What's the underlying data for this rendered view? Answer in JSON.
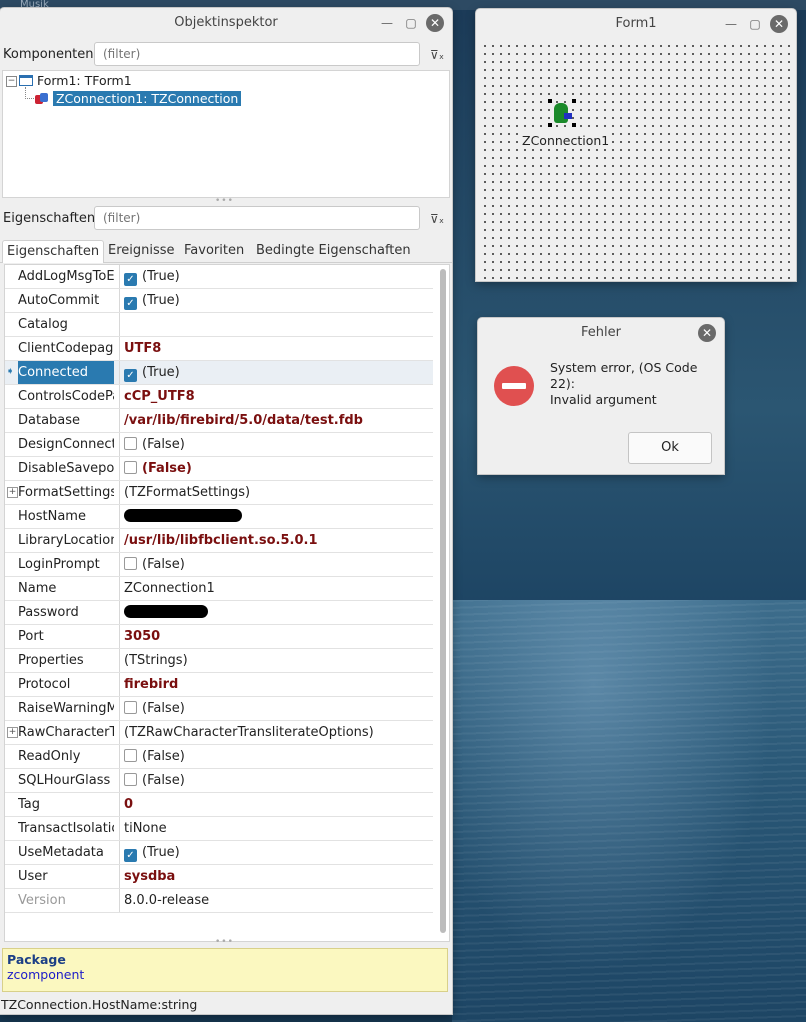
{
  "desktop": {
    "topstrip_text": "Musik"
  },
  "object_inspector": {
    "title": "Objektinspektor",
    "components_label": "Komponenten",
    "components_filter_placeholder": "(filter)",
    "tree": [
      {
        "label": "Form1: TForm1"
      },
      {
        "label": "ZConnection1: TZConnection"
      }
    ],
    "properties_label": "Eigenschaften",
    "properties_filter_placeholder": "(filter)",
    "tabs": [
      "Eigenschaften",
      "Ereignisse",
      "Favoriten",
      "Bedingte Eigenschaften"
    ],
    "rows": [
      {
        "name": "AddLogMsgToExceptionOrWarningMsg",
        "value": "(True)"
      },
      {
        "name": "AutoCommit",
        "value": "(True)"
      },
      {
        "name": "Catalog",
        "value": ""
      },
      {
        "name": "ClientCodepage",
        "value": "UTF8"
      },
      {
        "name": "Connected",
        "value": "(True)"
      },
      {
        "name": "ControlsCodePage",
        "value": "cCP_UTF8"
      },
      {
        "name": "Database",
        "value": "/var/lib/firebird/5.0/data/test.fdb"
      },
      {
        "name": "DesignConnection",
        "value": "(False)"
      },
      {
        "name": "DisableSavepoints",
        "value": "(False)"
      },
      {
        "name": "FormatSettings",
        "value": "(TZFormatSettings)"
      },
      {
        "name": "HostName",
        "value": ""
      },
      {
        "name": "LibraryLocation",
        "value": "/usr/lib/libfbclient.so.5.0.1"
      },
      {
        "name": "LoginPrompt",
        "value": "(False)"
      },
      {
        "name": "Name",
        "value": "ZConnection1"
      },
      {
        "name": "Password",
        "value": ""
      },
      {
        "name": "Port",
        "value": "3050"
      },
      {
        "name": "Properties",
        "value": "(TStrings)"
      },
      {
        "name": "Protocol",
        "value": "firebird"
      },
      {
        "name": "RaiseWarningMessages",
        "value": "(False)"
      },
      {
        "name": "RawCharacterTransliterateOptions",
        "value": "(TZRawCharacterTransliterateOptions)"
      },
      {
        "name": "ReadOnly",
        "value": "(False)"
      },
      {
        "name": "SQLHourGlass",
        "value": "(False)"
      },
      {
        "name": "Tag",
        "value": "0"
      },
      {
        "name": "TransactIsolationLevel",
        "value": "tiNone"
      },
      {
        "name": "UseMetadata",
        "value": "(True)"
      },
      {
        "name": "User",
        "value": "sysdba"
      },
      {
        "name": "Version",
        "value": "8.0.0-release"
      }
    ],
    "package_heading": "Package",
    "package_value": "zcomponent",
    "status_text": "TZConnection.HostName:string"
  },
  "form1": {
    "title": "Form1",
    "component_label": "ZConnection1"
  },
  "error_dialog": {
    "title": "Fehler",
    "message_line1": "System error, (OS Code 22):",
    "message_line2": "Invalid argument",
    "ok_label": "Ok"
  },
  "colors": {
    "selection": "#2a7ab0",
    "modified_value": "#7a0f0f",
    "error_icon": "#e05050",
    "package_bg": "#fbf8c0"
  }
}
